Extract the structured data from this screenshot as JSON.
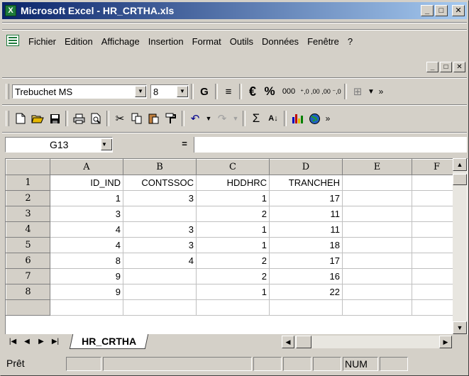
{
  "window": {
    "title": "Microsoft Excel - HR_CRTHA.xls",
    "minimize": "_",
    "maximize": "□",
    "close": "✕"
  },
  "menu": {
    "items": [
      "Fichier",
      "Edition",
      "Affichage",
      "Insertion",
      "Format",
      "Outils",
      "Données",
      "Fenêtre",
      "?"
    ]
  },
  "format_toolbar": {
    "font": "Trebuchet MS",
    "size": "8",
    "bold": "G",
    "euro": "€",
    "percent": "%",
    "thousands": "000",
    "inc_decimal": "⁺,0 ,00",
    "dec_decimal": ",00 ⁻,0"
  },
  "standard_toolbar": {
    "sum": "Σ"
  },
  "formula_bar": {
    "name_box": "G13",
    "equals": "=",
    "content": ""
  },
  "sheet": {
    "columns": [
      "A",
      "B",
      "C",
      "D",
      "E",
      "F"
    ],
    "rows": [
      {
        "n": "1",
        "cells": [
          "ID_IND",
          "CONTSSOC",
          "HDDHRC",
          "TRANCHEH",
          "",
          ""
        ]
      },
      {
        "n": "2",
        "cells": [
          "1",
          "3",
          "1",
          "17",
          "",
          ""
        ]
      },
      {
        "n": "3",
        "cells": [
          "3",
          "",
          "2",
          "11",
          "",
          ""
        ]
      },
      {
        "n": "4",
        "cells": [
          "4",
          "3",
          "1",
          "11",
          "",
          ""
        ]
      },
      {
        "n": "5",
        "cells": [
          "4",
          "3",
          "1",
          "18",
          "",
          ""
        ]
      },
      {
        "n": "6",
        "cells": [
          "8",
          "4",
          "2",
          "17",
          "",
          ""
        ]
      },
      {
        "n": "7",
        "cells": [
          "9",
          "",
          "2",
          "16",
          "",
          ""
        ]
      },
      {
        "n": "8",
        "cells": [
          "9",
          "",
          "1",
          "22",
          "",
          ""
        ]
      }
    ],
    "tab": "HR_CRTHA"
  },
  "status": {
    "ready": "Prêt",
    "num": "NUM"
  }
}
